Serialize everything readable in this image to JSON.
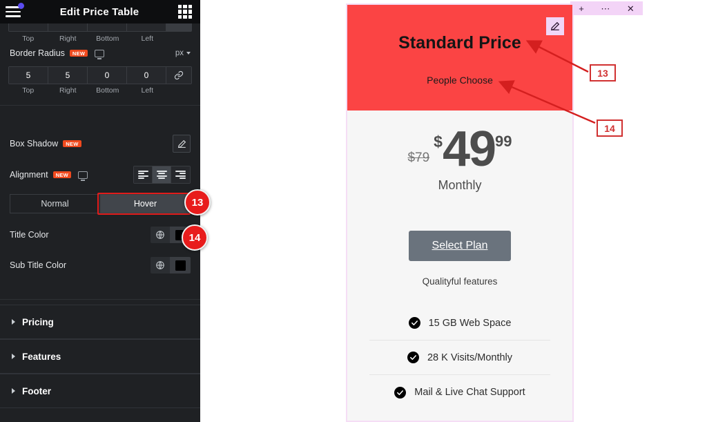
{
  "panel": {
    "title": "Edit Price Table",
    "menu_icon": "hamburger-icon",
    "grid_icon": "grid-apps-icon",
    "dimension_labels": [
      "Top",
      "Right",
      "Bottom",
      "Left"
    ],
    "border_radius": {
      "label": "Border Radius",
      "badge": "NEW",
      "unit": "px",
      "values": [
        "5",
        "5",
        "0",
        "0"
      ],
      "link_icon": "link-chain-icon",
      "device_icon": "desktop-monitor-icon"
    },
    "box_shadow": {
      "label": "Box Shadow",
      "badge": "NEW",
      "edit_icon": "pencil-edit-icon"
    },
    "alignment": {
      "label": "Alignment",
      "badge": "NEW",
      "device_icon": "desktop-monitor-icon",
      "options": [
        "align-left",
        "align-center",
        "align-right"
      ],
      "selected": "align-center"
    },
    "state_tabs": {
      "tabs": [
        "Normal",
        "Hover"
      ],
      "active": "Hover"
    },
    "color_controls": [
      {
        "label": "Title Color",
        "globe_icon": "globe-icon",
        "swatch": "#000000"
      },
      {
        "label": "Sub Title Color",
        "globe_icon": "globe-icon",
        "swatch": "#000000"
      }
    ],
    "sections": [
      {
        "label": "Pricing"
      },
      {
        "label": "Features"
      },
      {
        "label": "Footer"
      }
    ]
  },
  "preview": {
    "widget_toolbar": {
      "add": "+",
      "more": "⋯",
      "close": "✕"
    },
    "edit_icon": "pencil-edit-icon",
    "header": {
      "title": "Standard Price",
      "subtitle": "People Choose",
      "background_color": "#fb4444"
    },
    "price": {
      "original": "$79",
      "currency": "$",
      "amount": "49",
      "cents": "99",
      "period": "Monthly"
    },
    "cta": {
      "label": "Select Plan",
      "note": "Qualityful features",
      "background_color": "#6a737d"
    },
    "features": [
      {
        "text": "15 GB Web Space",
        "icon": "check-circle-icon"
      },
      {
        "text": "28 K Visits/Monthly",
        "icon": "check-circle-icon"
      },
      {
        "text": "Mail & Live Chat Support",
        "icon": "check-circle-icon"
      }
    ]
  },
  "annotations": {
    "boxes": [
      {
        "id": "13",
        "label": "13"
      },
      {
        "id": "14",
        "label": "14"
      }
    ],
    "badges": [
      {
        "id": "13",
        "label": "13"
      },
      {
        "id": "14",
        "label": "14"
      }
    ],
    "color": "#d03030"
  }
}
